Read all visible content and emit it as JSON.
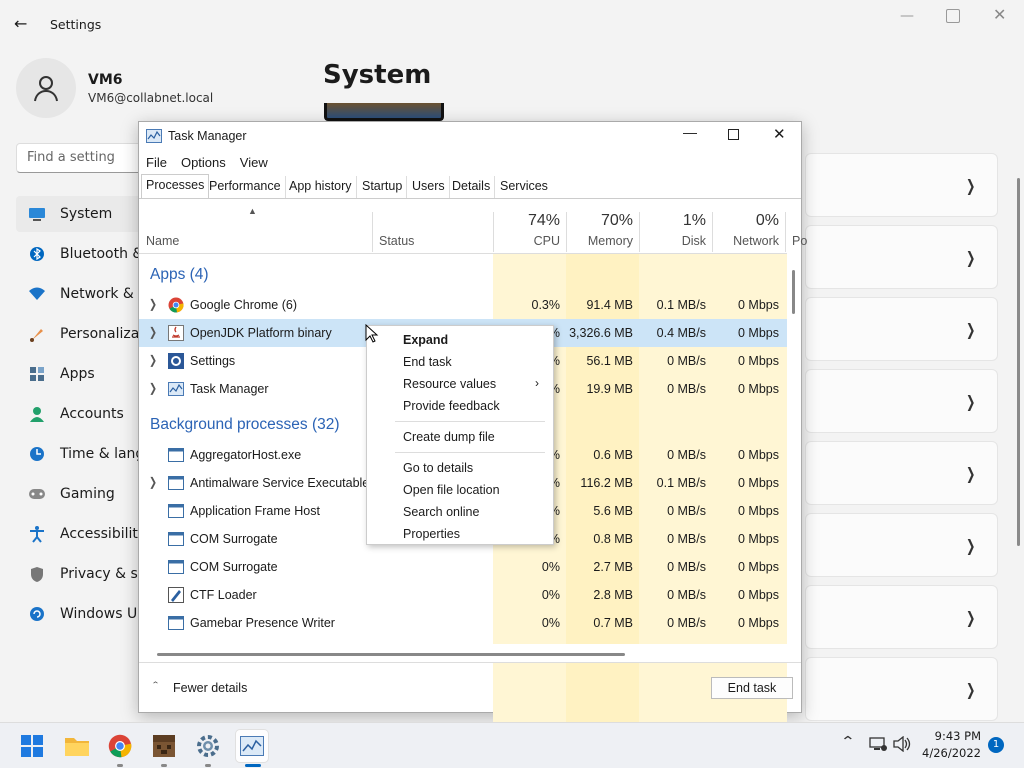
{
  "settings": {
    "title": "Settings",
    "user_name": "VM6",
    "user_email": "VM6@collabnet.local",
    "search_placeholder": "Find a setting",
    "page_title": "System",
    "nav": [
      {
        "label": "System",
        "icon": "monitor-icon"
      },
      {
        "label": "Bluetooth &",
        "icon": "bluetooth-icon"
      },
      {
        "label": "Network & i",
        "icon": "wifi-icon"
      },
      {
        "label": "Personalizati",
        "icon": "brush-icon"
      },
      {
        "label": "Apps",
        "icon": "apps-icon"
      },
      {
        "label": "Accounts",
        "icon": "person-icon"
      },
      {
        "label": "Time & lang",
        "icon": "clock-globe-icon"
      },
      {
        "label": "Gaming",
        "icon": "gamepad-icon"
      },
      {
        "label": "Accessibility",
        "icon": "accessibility-icon"
      },
      {
        "label": "Privacy & se",
        "icon": "shield-icon"
      },
      {
        "label": "Windows Up",
        "icon": "update-icon"
      }
    ],
    "accent": "#0067c0"
  },
  "task_manager": {
    "title": "Task Manager",
    "menu": [
      "File",
      "Options",
      "View"
    ],
    "tabs": [
      "Processes",
      "Performance",
      "App history",
      "Startup",
      "Users",
      "Details",
      "Services"
    ],
    "columns": {
      "name": "Name",
      "status": "Status",
      "cpu_pct": "74%",
      "cpu": "CPU",
      "mem_pct": "70%",
      "mem": "Memory",
      "disk_pct": "1%",
      "disk": "Disk",
      "net_pct": "0%",
      "net": "Network",
      "power": "Po"
    },
    "group_apps": "Apps (4)",
    "group_bg": "Background processes (32)",
    "rows": [
      {
        "name": "Google Chrome (6)",
        "cpu": "0.3%",
        "mem": "91.4 MB",
        "disk": "0.1 MB/s",
        "net": "0 Mbps"
      },
      {
        "name": "OpenJDK Platform binary",
        "cpu": "%",
        "mem": "3,326.6 MB",
        "disk": "0.4 MB/s",
        "net": "0 Mbps"
      },
      {
        "name": "Settings",
        "cpu": "%",
        "mem": "56.1 MB",
        "disk": "0 MB/s",
        "net": "0 Mbps"
      },
      {
        "name": "Task Manager",
        "cpu": "%",
        "mem": "19.9 MB",
        "disk": "0 MB/s",
        "net": "0 Mbps"
      },
      {
        "name": "AggregatorHost.exe",
        "cpu": "%",
        "mem": "0.6 MB",
        "disk": "0 MB/s",
        "net": "0 Mbps"
      },
      {
        "name": "Antimalware Service Executable",
        "cpu": "%",
        "mem": "116.2 MB",
        "disk": "0.1 MB/s",
        "net": "0 Mbps"
      },
      {
        "name": "Application Frame Host",
        "cpu": "%",
        "mem": "5.6 MB",
        "disk": "0 MB/s",
        "net": "0 Mbps"
      },
      {
        "name": "COM Surrogate",
        "cpu": "%",
        "mem": "0.8 MB",
        "disk": "0 MB/s",
        "net": "0 Mbps"
      },
      {
        "name": "COM Surrogate",
        "cpu": "0%",
        "mem": "2.7 MB",
        "disk": "0 MB/s",
        "net": "0 Mbps"
      },
      {
        "name": "CTF Loader",
        "cpu": "0%",
        "mem": "2.8 MB",
        "disk": "0 MB/s",
        "net": "0 Mbps"
      },
      {
        "name": "Gamebar Presence Writer",
        "cpu": "0%",
        "mem": "0.7 MB",
        "disk": "0 MB/s",
        "net": "0 Mbps"
      }
    ],
    "fewer_details": "Fewer details",
    "end_task": "End task"
  },
  "context_menu": {
    "items": [
      "Expand",
      "End task",
      "Resource values",
      "Provide feedback",
      "Create dump file",
      "Go to details",
      "Open file location",
      "Search online",
      "Properties"
    ]
  },
  "taskbar": {
    "time": "9:43 PM",
    "date": "4/26/2022",
    "notification_count": "1",
    "apps": [
      "start-icon",
      "file-explorer-icon",
      "chrome-icon",
      "minecraft-icon",
      "settings-gear-icon",
      "task-manager-icon"
    ]
  }
}
